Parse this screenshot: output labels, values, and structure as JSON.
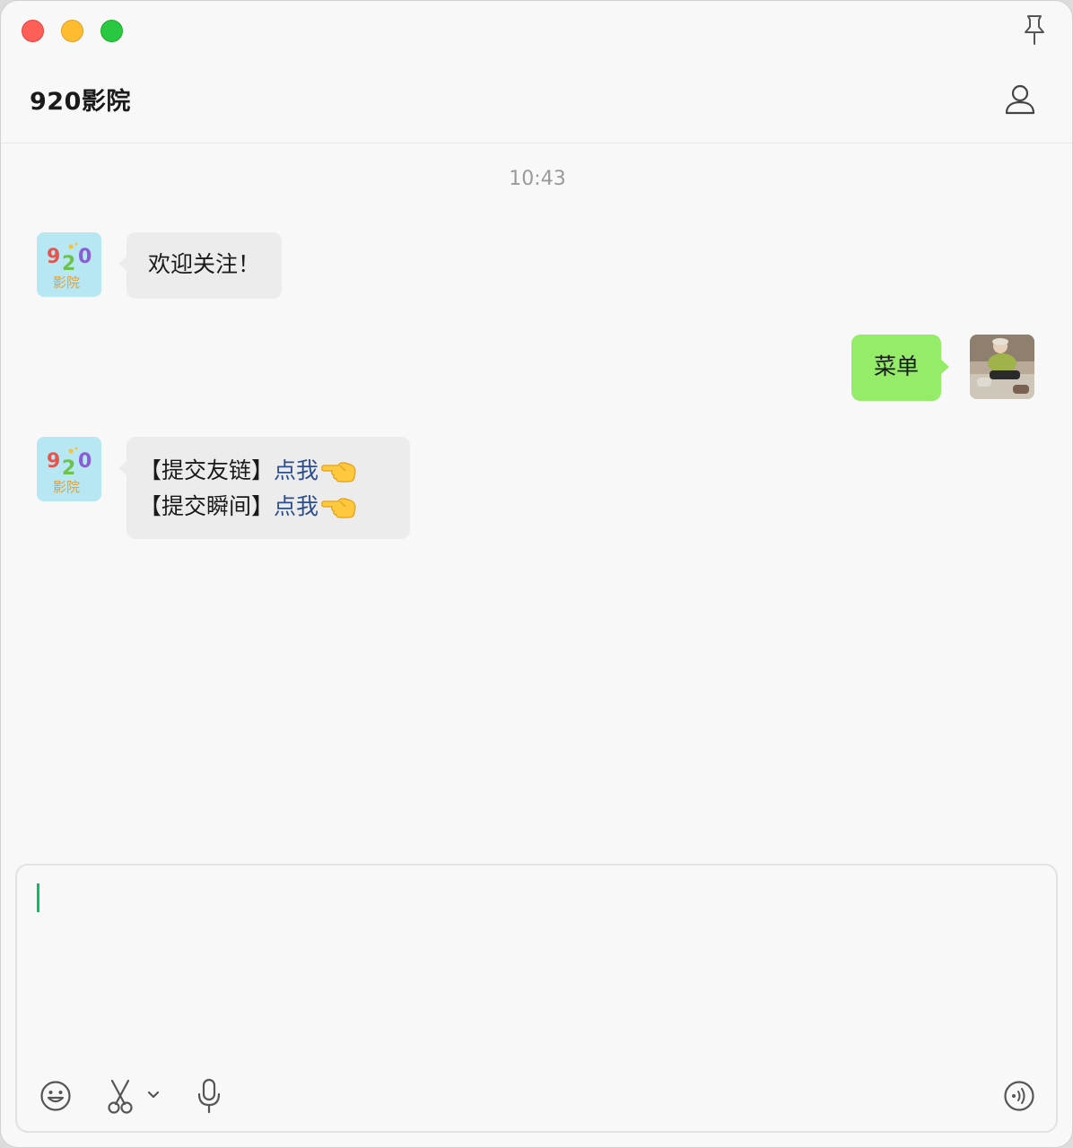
{
  "window": {
    "title": "920影院"
  },
  "chat": {
    "timestamp": "10:43",
    "messages": [
      {
        "from": "official-account",
        "text": "欢迎关注！"
      },
      {
        "from": "me",
        "text": "菜单"
      },
      {
        "from": "official-account",
        "lines": [
          {
            "prefix": "【提交友链】",
            "link": "点我",
            "emoji": "backhand-index-pointing-left"
          },
          {
            "prefix": "【提交瞬间】",
            "link": "点我",
            "emoji": "backhand-index-pointing-left"
          }
        ]
      }
    ]
  },
  "bot_avatar": {
    "digits": [
      "9",
      "2",
      "0"
    ],
    "caption": "影院"
  },
  "composer": {
    "value": "",
    "tools": [
      "emoji-icon",
      "scissors-icon",
      "chevron-down-icon",
      "microphone-icon",
      "voice-call-icon"
    ]
  },
  "colors": {
    "accent": "#07c160",
    "outgoing_bubble": "#95ec69",
    "incoming_bubble": "#ececec",
    "link": "#2d4e8e"
  }
}
